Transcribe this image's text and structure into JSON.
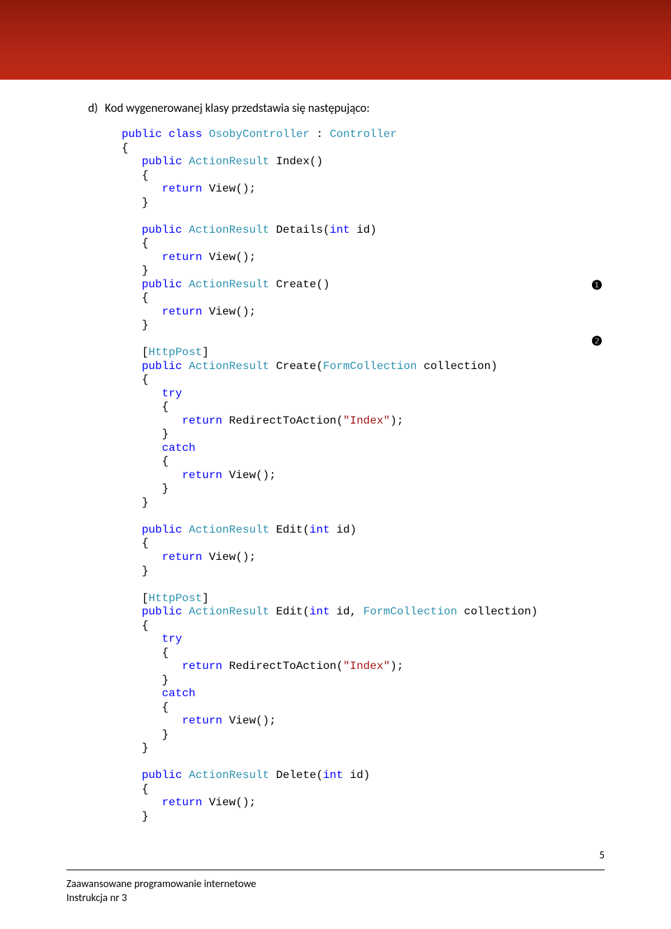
{
  "heading": {
    "letter": "d)",
    "text": "Kod wygenerowanej  klasy przedstawia się następująco:"
  },
  "code": {
    "kw_public": "public",
    "kw_class": "class",
    "kw_return": "return",
    "kw_try": "try",
    "kw_catch": "catch",
    "kw_int": "int",
    "type_OsobyController": "OsobyController",
    "type_Controller": "Controller",
    "type_ActionResult": "ActionResult",
    "type_FormCollection": "FormCollection",
    "type_HttpPost": "HttpPost",
    "fn_Index": "Index()",
    "fn_View": "View();",
    "fn_Details": "Details(",
    "fn_Create": "Create()",
    "fn_CreateP": "Create(",
    "fn_Edit": "Edit(",
    "fn_Delete": "Delete(",
    "fn_Redirect": "RedirectToAction(",
    "str_Index": "\"Index\"",
    "var_id": " id)",
    "var_id_comma": " id, ",
    "var_collection": " collection)",
    "paren_close_semi": ");",
    "lbrace": "{",
    "rbrace": "}",
    "lbracket": "[",
    "rbracket": "]",
    "colon": " : "
  },
  "annotations": {
    "one": "❶",
    "two": "❷"
  },
  "footer": {
    "line1": "Zaawansowane programowanie internetowe",
    "line2": "Instrukcja nr 3",
    "page": "5"
  }
}
